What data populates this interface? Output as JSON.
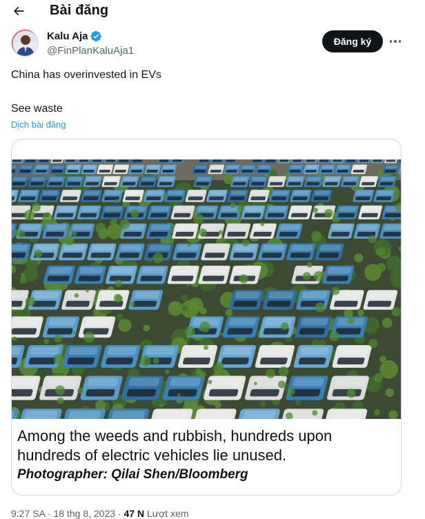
{
  "header": {
    "title": "Bài đăng",
    "back_icon": "arrow-left-icon"
  },
  "author": {
    "name": "Kalu Aja",
    "handle": "@FinPlanKaluAja1",
    "verified_icon": "verified-badge-icon",
    "verified_color": "#1d9bf0"
  },
  "actions": {
    "follow_label": "Đăng ký",
    "more_icon": "more-horizontal-icon"
  },
  "tweet": {
    "line1": "China has overinvested in EVs",
    "line2": "See waste",
    "translate_label": "Dịch bài đăng"
  },
  "media": {
    "photo_icon": "parked-cars-photo",
    "caption_line1": "Among the weeds and rubbish, hundreds upon",
    "caption_line2": "hundreds of electric vehicles lie unused.",
    "caption_credit": "Photographer: Qilai Shen/Bloomberg"
  },
  "meta": {
    "time": "9:27 SA",
    "separator": " · ",
    "date": "18 thg 8, 2023",
    "views_count": "47 N",
    "views_label": " Lượt xem"
  },
  "colors": {
    "link": "#1d9bf0",
    "secondary_text": "#536471",
    "primary_text": "#0f1419",
    "border": "#cfd9de"
  }
}
